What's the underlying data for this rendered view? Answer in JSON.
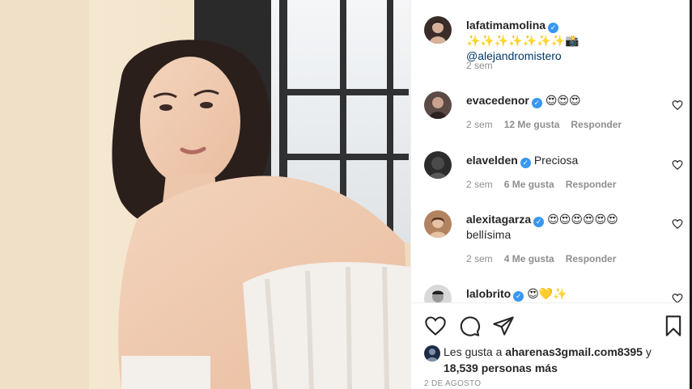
{
  "post": {
    "author": "lafatimamolina",
    "caption_emoji": "✨✨✨✨✨✨✨📸",
    "caption_mention": "@alejandromistero",
    "time": "2 sem"
  },
  "comments": [
    {
      "user": "evacedenor",
      "text": "😍😍😍",
      "text2": "",
      "time": "2 sem",
      "likes": "12 Me gusta",
      "reply": "Responder"
    },
    {
      "user": "elavelden",
      "text": "Preciosa",
      "text2": "",
      "time": "2 sem",
      "likes": "6 Me gusta",
      "reply": "Responder"
    },
    {
      "user": "alexitagarza",
      "text": "😍😍😍😍😍😍",
      "text2": "bellísima",
      "time": "2 sem",
      "likes": "4 Me gusta",
      "reply": "Responder"
    },
    {
      "user": "lalobrito",
      "text": "😍💛✨",
      "text2": "",
      "time": "",
      "likes": "",
      "reply": ""
    }
  ],
  "likes": {
    "prefix": "Les gusta a",
    "user": "aharenas3gmail.com8395",
    "joiner": "y",
    "count": "18,539 personas más"
  },
  "date": "2 DE AGOSTO",
  "icons": {
    "like": "heart-icon",
    "comment": "comment-icon",
    "share": "send-icon",
    "save": "bookmark-icon"
  },
  "colors": {
    "verified": "#3897f0",
    "mention": "#00376b",
    "meta": "#8e8e8e"
  }
}
